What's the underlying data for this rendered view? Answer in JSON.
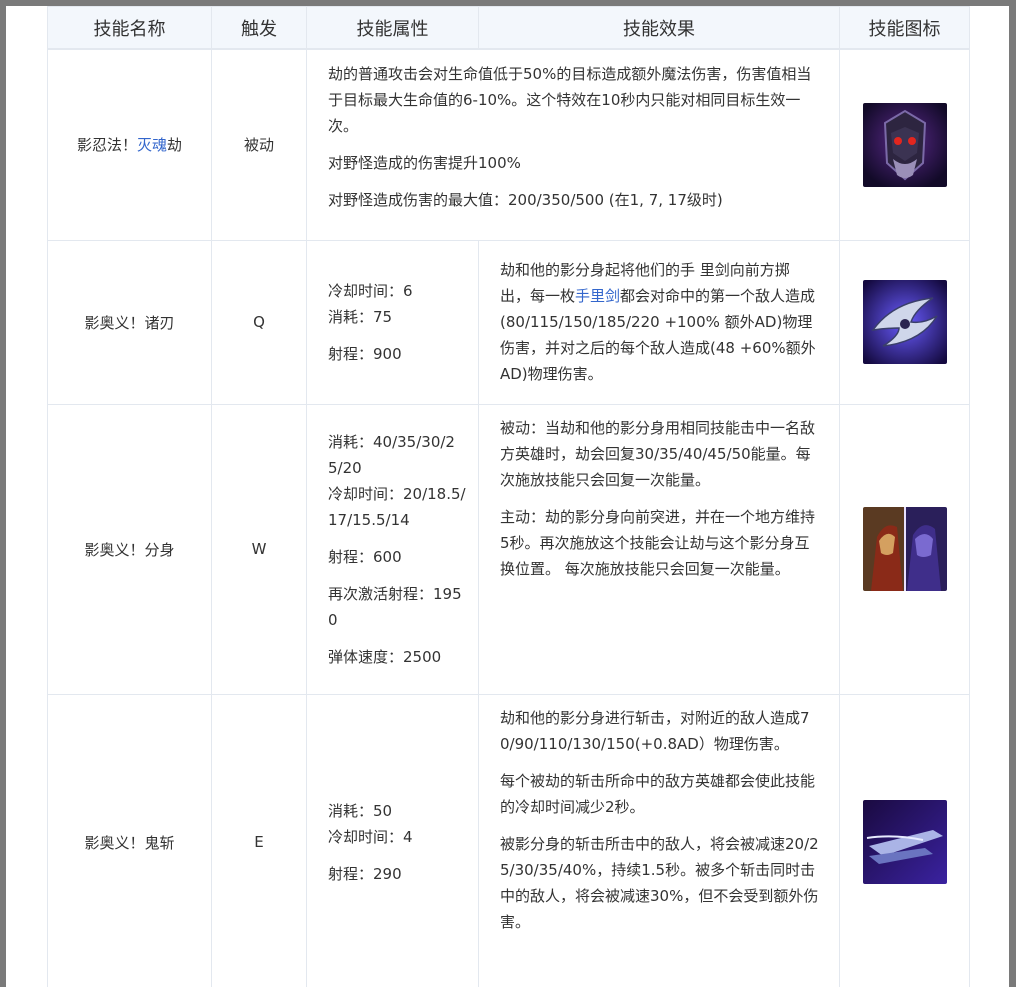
{
  "headers": {
    "name": "技能名称",
    "trigger": "触发",
    "attributes": "技能属性",
    "effect": "技能效果",
    "icon": "技能图标"
  },
  "passive": {
    "name_prefix": "影忍法！",
    "name_link": "灭魂",
    "name_suffix": "劫",
    "trigger": "被动",
    "effect": [
      "劫的普通攻击会对生命值低于50%的目标造成额外魔法伤害，伤害值相当于目标最大生命值的6-10%。这个特效在10秒内只能对相同目标生效一次。",
      "对野怪造成的伤害提升100%",
      "对野怪造成伤害的最大值：200/350/500 (在1, 7, 17级时)"
    ],
    "icon": "passive-skill-icon"
  },
  "q": {
    "name": "影奥义！诸刃",
    "trigger": "Q",
    "attributes": {
      "cooldown": "冷却时间：6",
      "cost": "消耗：75",
      "range": "射程：900"
    },
    "effect": {
      "part1": "劫和他的影分身起将他们的手 里剑向前方掷出，每一枚",
      "link": "手里剑",
      "part2": "都会对命中的第一个敌人造成(80/115/150/185/220 +100% 额外AD)物理伤害，并对之后的每个敌人造成(48 +60%额外AD)物理伤害。"
    },
    "icon": "shuriken-skill-icon"
  },
  "w": {
    "name": "影奥义！分身",
    "trigger": "W",
    "attributes": {
      "cost": "消耗：40/35/30/25/20",
      "cooldown": "冷却时间：20/18.5/17/15.5/14",
      "range": "射程：600",
      "recast_range": "再次激活射程：1950",
      "speed": "弹体速度：2500"
    },
    "effect": [
      "被动：当劫和他的影分身用相同技能击中一名敌方英雄时，劫会回复30/35/40/45/50能量。每次施放技能只会回复一次能量。",
      "主动：劫的影分身向前突进，并在一个地方维持5秒。再次施放这个技能会让劫与这个影分身互换位置。 每次施放技能只会回复一次能量。"
    ],
    "icon": "shadow-skill-icon"
  },
  "e": {
    "name": "影奥义！鬼斩",
    "trigger": "E",
    "attributes": {
      "cost": "消耗：50",
      "cooldown": "冷却时间：4",
      "range": "射程：290"
    },
    "effect": [
      "劫和他的影分身进行斩击，对附近的敌人造成70/90/110/130/150(+0.8AD）物理伤害。",
      "每个被劫的斩击所命中的敌方英雄都会使此技能的冷却时间减少2秒。",
      "被影分身的斩击所击中的敌人，将会被减速20/25/30/35/40%，持续1.5秒。被多个斩击同时击中的敌人，将会被减速30%，但不会受到额外伤害。"
    ],
    "icon": "slash-skill-icon"
  }
}
